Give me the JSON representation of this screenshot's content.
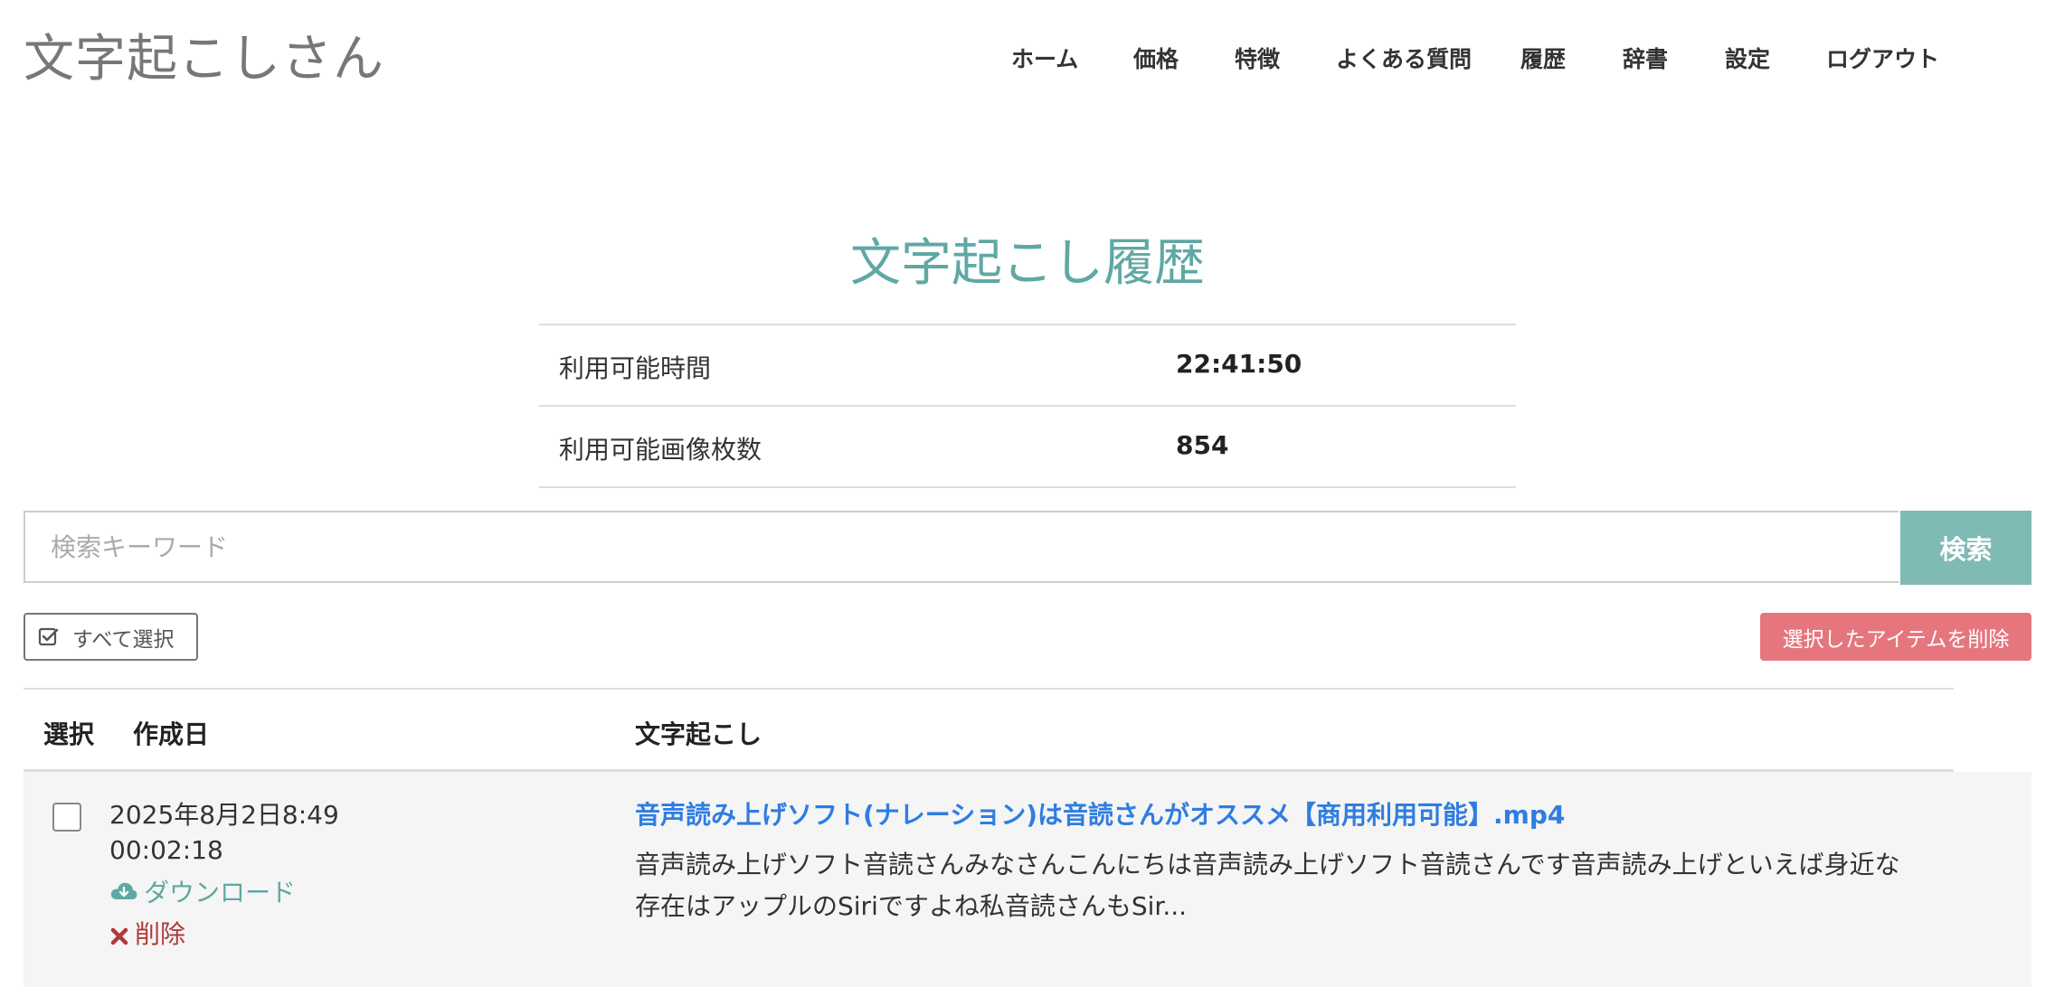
{
  "header": {
    "brand": "文字起こしさん",
    "nav": [
      "ホーム",
      "価格",
      "特徴",
      "よくある質問",
      "履歴",
      "辞書",
      "設定",
      "ログアウト"
    ]
  },
  "page": {
    "title": "文字起こし履歴"
  },
  "stats": [
    {
      "label": "利用可能時間",
      "value": "22:41:50"
    },
    {
      "label": "利用可能画像枚数",
      "value": "854"
    }
  ],
  "search": {
    "placeholder": "検索キーワード",
    "button_label": "検索"
  },
  "actions": {
    "select_all_label": "すべて選択",
    "delete_selected_label": "選択したアイテムを削除"
  },
  "table": {
    "headers": [
      "選択",
      "作成日",
      "文字起こし"
    ],
    "rows": [
      {
        "created": "2025年8月2日8:49",
        "duration": "00:02:18",
        "download_label": "ダウンロード",
        "delete_label": "削除",
        "title": "音声読み上げソフト(ナレーション)は音読さんがオススメ【商用利用可能】.mp4",
        "snippet": "音声読み上げソフト音読さんみなさんこんにちは音声読み上げソフト音読さんです音声読み上げといえば身近な存在はアップルのSiriですよね私音読さんもSir..."
      }
    ]
  },
  "colors": {
    "accent": "#5fa8a4",
    "search_button": "#7fbab5",
    "danger_button": "#e6767e",
    "link": "#2f7de1",
    "delete_text": "#b03a3a"
  },
  "icons": {
    "select_all": "check-square-icon",
    "download": "cloud-download-icon",
    "delete": "x-icon"
  }
}
